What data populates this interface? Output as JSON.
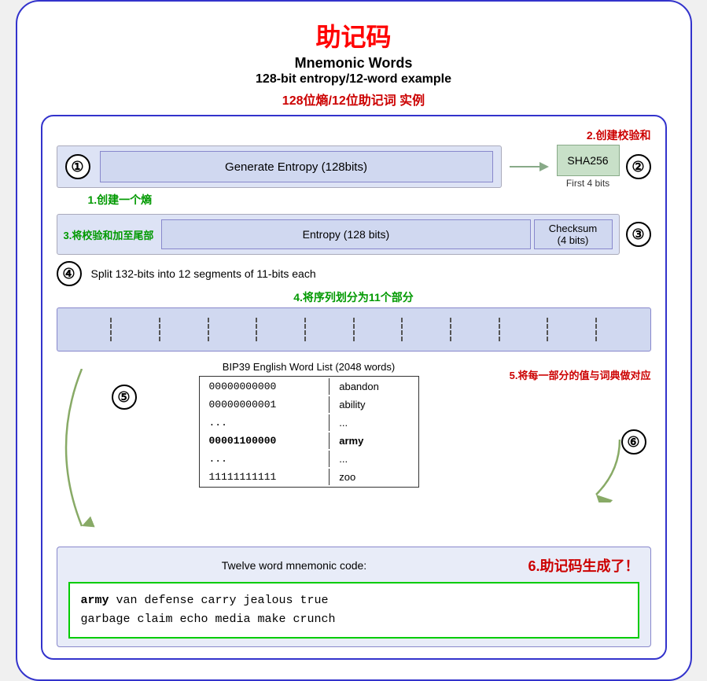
{
  "title": {
    "cn": "助记码",
    "en1": "Mnemonic Words",
    "en2": "128-bit entropy/12-word example",
    "cn2": "128位熵/12位助记词 实例"
  },
  "steps": {
    "s1": "1.创建一个熵",
    "s2": "2.创建校验和",
    "s3": "3.将校验和加至尾部",
    "s4": "4.将序列划分为11个部分",
    "s5": "5.将每一部分的值与词典做对应",
    "s6": "6.助记码生成了！"
  },
  "boxes": {
    "entropy_generate": "Generate Entropy (128bits)",
    "sha256": "SHA256",
    "first4bits": "First 4 bits",
    "entropy128": "Entropy (128 bits)",
    "checksum": "Checksum\n(4 bits)",
    "split_text": "Split 132-bits into 12 segments of 11-bits each",
    "bip39_label": "BIP39 English Word List (2048 words)",
    "twelve_word": "Twelve word mnemonic code:",
    "step4_cn": "4.将序列划分为11个部分"
  },
  "bip39_table": [
    {
      "bits": "00000000000",
      "word": "abandon"
    },
    {
      "bits": "00000000001",
      "word": "ability"
    },
    {
      "bits": "...",
      "word": "..."
    },
    {
      "bits": "00001100000",
      "word": "army",
      "highlight": true
    },
    {
      "bits": "...",
      "word": "..."
    },
    {
      "bits": "11111111111",
      "word": "zoo"
    }
  ],
  "mnemonic": {
    "line1": "army van defense carry jealous true",
    "line2": "garbage claim echo media make crunch",
    "bold_word": "army"
  },
  "circle_nums": [
    "①",
    "②",
    "③",
    "④",
    "⑤",
    "⑥"
  ]
}
